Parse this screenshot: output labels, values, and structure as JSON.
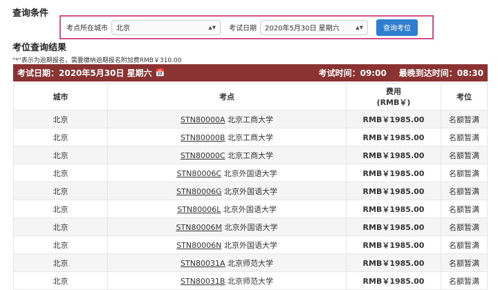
{
  "titles": {
    "conditions": "查询条件",
    "results": "考位查询结果"
  },
  "form": {
    "city_label": "考点所在城市",
    "city_value": "北京",
    "date_label": "考试日期",
    "date_value": "2020年5月30日 星期六",
    "search_button": "查询考位"
  },
  "note": "\"*\"表示为逾期报名，需要缴纳逾期报名附加费RMB￥310.00",
  "bar": {
    "date": "考试日期：2020年5月30日 星期六",
    "exam_time": "考试时间：09:00",
    "arrival": "最晚到达时间：08:30"
  },
  "table": {
    "headers": {
      "city": "城市",
      "site": "考点",
      "fee_line1": "费用",
      "fee_line2": "(RMB￥)",
      "seat": "考位"
    },
    "rows": [
      {
        "city": "北京",
        "code": "STN80000A",
        "name": "北京工商大学",
        "fee": "RMB￥1985.00",
        "seat": "名额暂满"
      },
      {
        "city": "北京",
        "code": "STN80000B",
        "name": "北京工商大学",
        "fee": "RMB￥1985.00",
        "seat": "名额暂满"
      },
      {
        "city": "北京",
        "code": "STN80000C",
        "name": "北京工商大学",
        "fee": "RMB￥1985.00",
        "seat": "名额暂满"
      },
      {
        "city": "北京",
        "code": "STN80006C",
        "name": "北京外国语大学",
        "fee": "RMB￥1985.00",
        "seat": "名额暂满"
      },
      {
        "city": "北京",
        "code": "STN80006G",
        "name": "北京外国语大学",
        "fee": "RMB￥1985.00",
        "seat": "名额暂满"
      },
      {
        "city": "北京",
        "code": "STN80006L",
        "name": "北京外国语大学",
        "fee": "RMB￥1985.00",
        "seat": "名额暂满"
      },
      {
        "city": "北京",
        "code": "STN80006M",
        "name": "北京外国语大学",
        "fee": "RMB￥1985.00",
        "seat": "名额暂满"
      },
      {
        "city": "北京",
        "code": "STN80006N",
        "name": "北京外国语大学",
        "fee": "RMB￥1985.00",
        "seat": "名额暂满"
      },
      {
        "city": "北京",
        "code": "STN80031A",
        "name": "北京师范大学",
        "fee": "RMB￥1985.00",
        "seat": "名额暂满"
      },
      {
        "city": "北京",
        "code": "STN80031B",
        "name": "北京师范大学",
        "fee": "RMB￥1985.00",
        "seat": "名额暂满"
      }
    ]
  }
}
